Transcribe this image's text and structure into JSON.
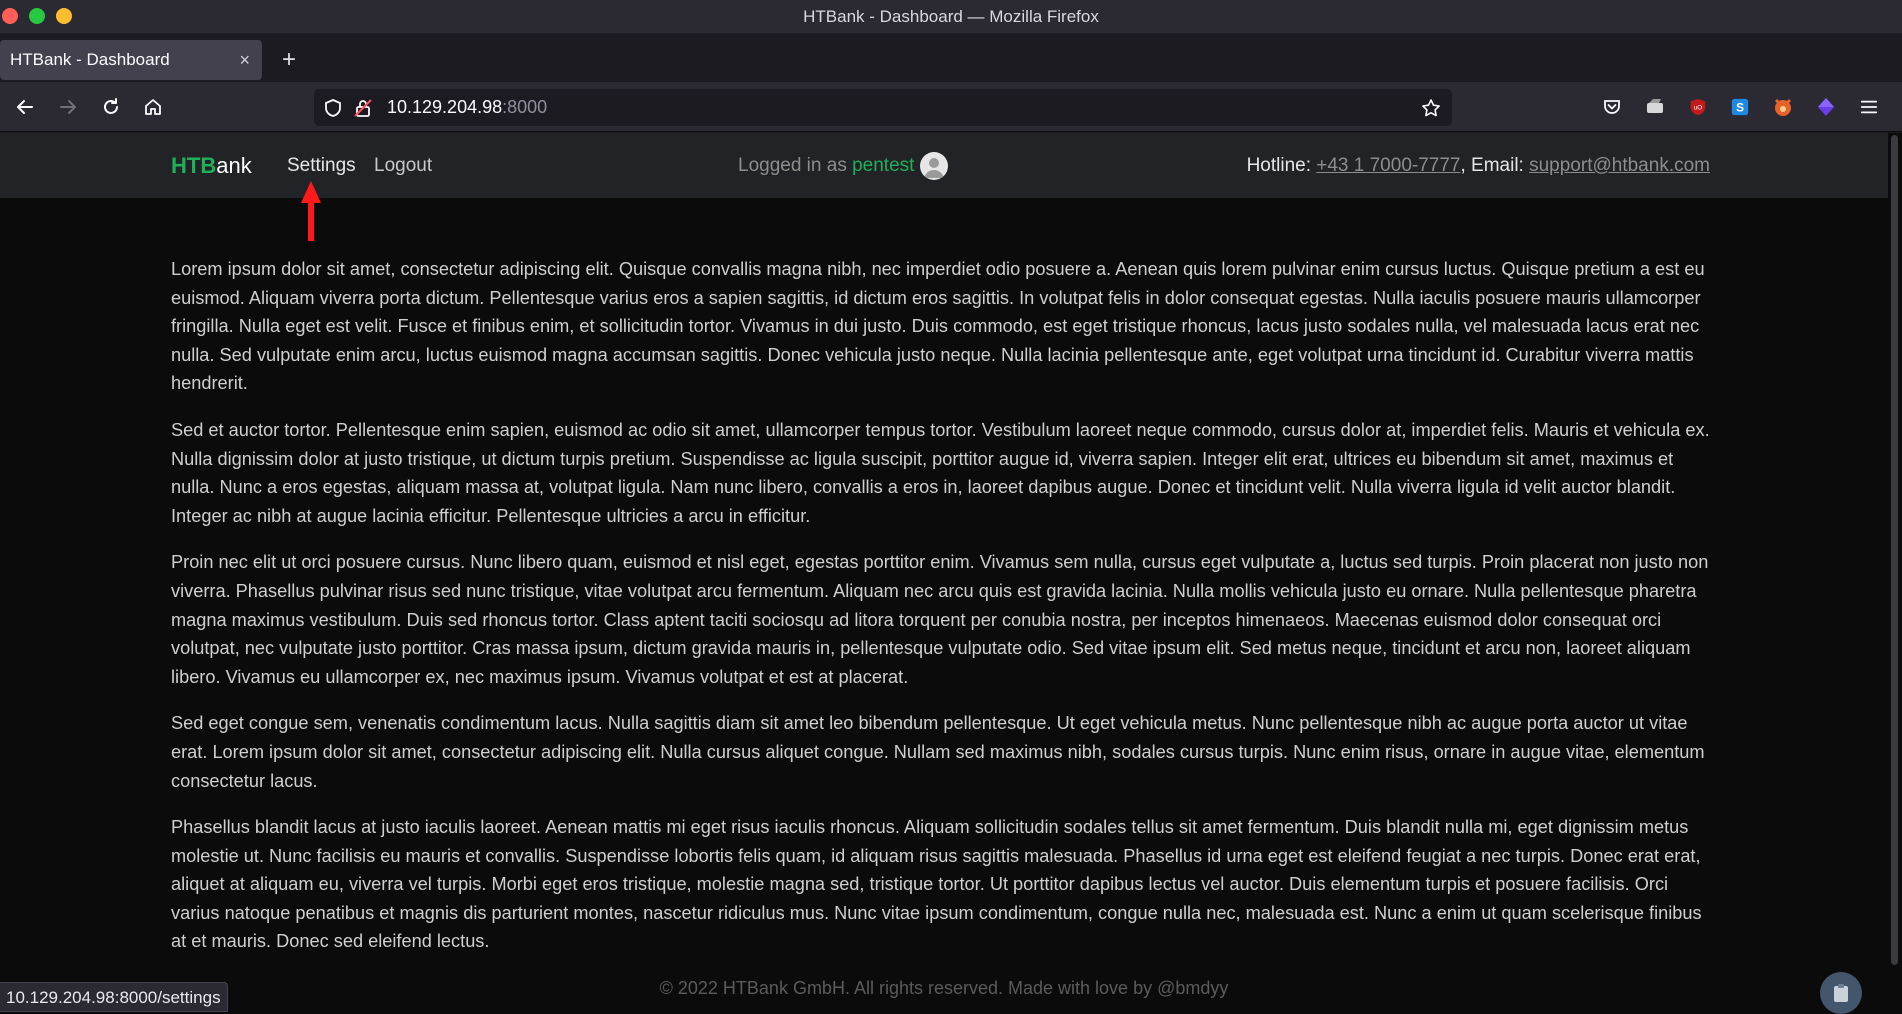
{
  "window": {
    "title": "HTBank - Dashboard — Mozilla Firefox"
  },
  "tabs": [
    {
      "label": "HTBank - Dashboard",
      "close": "×"
    }
  ],
  "newtab": "+",
  "url": {
    "host": "10.129.204.98",
    "port": ":8000"
  },
  "site": {
    "brand_htb": "HTB",
    "brand_rest": "ank",
    "nav": {
      "settings": "Settings",
      "logout": "Logout"
    },
    "logged_in_prefix": "Logged in as ",
    "username": "pentest",
    "hotline_label": "Hotline: ",
    "hotline_number": "+43 1 7000-7777",
    "email_label": ", Email: ",
    "email": "support@htbank.com"
  },
  "paragraphs": [
    "Lorem ipsum dolor sit amet, consectetur adipiscing elit. Quisque convallis magna nibh, nec imperdiet odio posuere a. Aenean quis lorem pulvinar enim cursus luctus. Quisque pretium a est eu euismod. Aliquam viverra porta dictum. Pellentesque varius eros a sapien sagittis, id dictum eros sagittis. In volutpat felis in dolor consequat egestas. Nulla iaculis posuere mauris ullamcorper fringilla. Nulla eget est velit. Fusce et finibus enim, et sollicitudin tortor. Vivamus in dui justo. Duis commodo, est eget tristique rhoncus, lacus justo sodales nulla, vel malesuada lacus erat nec nulla. Sed vulputate enim arcu, luctus euismod magna accumsan sagittis. Donec vehicula justo neque. Nulla lacinia pellentesque ante, eget volutpat urna tincidunt id. Curabitur viverra mattis hendrerit.",
    "Sed et auctor tortor. Pellentesque enim sapien, euismod ac odio sit amet, ullamcorper tempus tortor. Vestibulum laoreet neque commodo, cursus dolor at, imperdiet felis. Mauris et vehicula ex. Nulla dignissim dolor at justo tristique, ut dictum turpis pretium. Suspendisse ac ligula suscipit, porttitor augue id, viverra sapien. Integer elit erat, ultrices eu bibendum sit amet, maximus et nulla. Nunc a eros egestas, aliquam massa at, volutpat ligula. Nam nunc libero, convallis a eros in, laoreet dapibus augue. Donec et tincidunt velit. Nulla viverra ligula id velit auctor blandit. Integer ac nibh at augue lacinia efficitur. Pellentesque ultricies a arcu in efficitur.",
    "Proin nec elit ut orci posuere cursus. Nunc libero quam, euismod et nisl eget, egestas porttitor enim. Vivamus sem nulla, cursus eget vulputate a, luctus sed turpis. Proin placerat non justo non viverra. Phasellus pulvinar risus sed nunc tristique, vitae volutpat arcu fermentum. Aliquam nec arcu quis est gravida lacinia. Nulla mollis vehicula justo eu ornare. Nulla pellentesque pharetra magna maximus vestibulum. Duis sed rhoncus tortor. Class aptent taciti sociosqu ad litora torquent per conubia nostra, per inceptos himenaeos. Maecenas euismod dolor consequat orci volutpat, nec vulputate justo porttitor. Cras massa ipsum, dictum gravida mauris in, pellentesque vulputate odio. Sed vitae ipsum elit. Sed metus neque, tincidunt et arcu non, laoreet aliquam libero. Vivamus eu ullamcorper ex, nec maximus ipsum. Vivamus volutpat et est at placerat.",
    "Sed eget congue sem, venenatis condimentum lacus. Nulla sagittis diam sit amet leo bibendum pellentesque. Ut eget vehicula metus. Nunc pellentesque nibh ac augue porta auctor ut vitae erat. Lorem ipsum dolor sit amet, consectetur adipiscing elit. Nulla cursus aliquet congue. Nullam sed maximus nibh, sodales cursus turpis. Nunc enim risus, ornare in augue vitae, elementum consectetur lacus.",
    "Phasellus blandit lacus at justo iaculis laoreet. Aenean mattis mi eget risus iaculis rhoncus. Aliquam sollicitudin sodales tellus sit amet fermentum. Duis blandit nulla mi, eget dignissim metus molestie ut. Nunc facilisis eu mauris et convallis. Suspendisse lobortis felis quam, id aliquam risus sagittis malesuada. Phasellus id urna eget est eleifend feugiat a nec turpis. Donec erat erat, aliquet at aliquam eu, viverra vel turpis. Morbi eget eros tristique, molestie magna sed, tristique tortor. Ut porttitor dapibus lectus vel auctor. Duis elementum turpis et posuere facilisis. Orci varius natoque penatibus et magnis dis parturient montes, nascetur ridiculus mus. Nunc vitae ipsum condimentum, congue nulla nec, malesuada est. Nunc a enim ut quam scelerisque finibus at et mauris. Donec sed eleifend lectus."
  ],
  "footer": "© 2022 HTBank GmbH. All rights reserved. Made with love by @bmdyy",
  "status_link": "10.129.204.98:8000/settings",
  "icons": {
    "back": "back-arrow-icon",
    "forward": "forward-arrow-icon",
    "reload": "reload-icon",
    "home": "home-icon",
    "shield": "tracking-shield-icon",
    "lock": "insecure-lock-icon",
    "star": "bookmark-star-icon",
    "pocket": "pocket-icon",
    "ext1": "extension-icon",
    "ublock": "ublock-icon",
    "ext_s": "extension-s-icon",
    "foxy": "foxyproxy-icon",
    "ext_purple": "extension-purple-icon",
    "menu": "hamburger-menu-icon",
    "avatar": "user-avatar-icon",
    "arrow": "red-annotation-arrow",
    "clipboard": "clipboard-icon"
  },
  "colors": {
    "brand_green": "#20b05a",
    "annotation_red": "#ff1a1a",
    "page_bg": "#0b0b0b",
    "nav_bg": "#222326"
  }
}
